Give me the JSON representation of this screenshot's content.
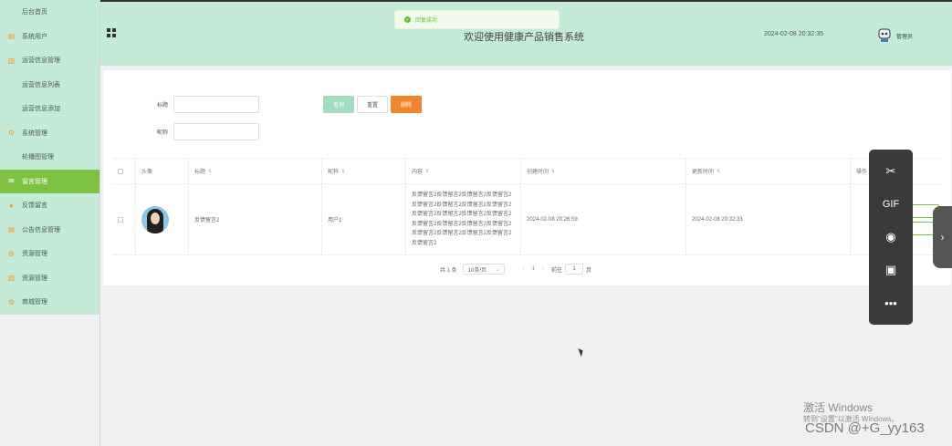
{
  "sidebar": {
    "items": [
      {
        "label": "后台首页",
        "type": "sub"
      },
      {
        "label": "系统用户",
        "icon": "document-icon",
        "type": "top"
      },
      {
        "label": "运营信息管理",
        "icon": "chart-icon",
        "type": "top"
      },
      {
        "label": "运营信息列表",
        "type": "sub"
      },
      {
        "label": "运营信息添加",
        "type": "sub"
      },
      {
        "label": "系统管理",
        "icon": "gear-icon",
        "type": "top"
      },
      {
        "label": "轮播图管理",
        "type": "sub"
      },
      {
        "label": "留言管理",
        "icon": "message-icon",
        "type": "top-active"
      },
      {
        "label": "反馈留言",
        "icon": "location-icon",
        "type": "top"
      },
      {
        "label": "公告信息管理",
        "icon": "document-icon",
        "type": "top"
      },
      {
        "label": "资源管理",
        "icon": "gear-icon",
        "type": "top"
      },
      {
        "label": "资源管理",
        "icon": "chart-icon",
        "type": "top"
      },
      {
        "label": "商城管理",
        "icon": "gear-icon",
        "type": "top"
      }
    ]
  },
  "header": {
    "title": "欢迎使用健康产品销售系统",
    "datetime": "2024-02-08 20:32:35",
    "user": "管理员"
  },
  "toast": {
    "message": "回复成功"
  },
  "search": {
    "title_label": "标题",
    "nickname_label": "昵称",
    "query_button": "查询",
    "reset_button": "重置",
    "delete_button": "删除"
  },
  "table": {
    "headers": [
      "",
      "头像",
      "标题",
      "昵称",
      "内容",
      "创建时间",
      "更新时间",
      "操作"
    ],
    "rows": [
      {
        "title": "反馈留言2",
        "nickname": "用户1",
        "content": "反馈留言2反馈留言2反馈留言2反馈留言2反馈留言2反馈留言2反馈留言2反馈留言2反馈留言2反馈留言2反馈留言2反馈留言2反馈留言2反馈留言2反馈留言2反馈留言2反馈留言2反馈留言2反馈留言2反馈留言2反馈留言2",
        "created": "2024-02-08 20:26:59",
        "updated": "2024-02-08 20:32:33"
      }
    ]
  },
  "pagination": {
    "total": "共 1 条",
    "page_size": "10条/页",
    "current_page": "1",
    "goto_label": "前往",
    "goto_value": "1",
    "page_suffix": "页"
  },
  "float_toolbar": {
    "icons": [
      "scissors-icon",
      "gif-icon",
      "record-icon",
      "image-icon",
      "more-icon"
    ],
    "gif_label": "GIF"
  },
  "watermarks": {
    "windows_title": "激活 Windows",
    "windows_sub": "转到\"设置\"以激活 Windows。",
    "csdn": "CSDN @+G_yy163"
  },
  "colors": {
    "menu_bg": "#c5ead7",
    "active": "#7fc241",
    "delete": "#f0852d",
    "query": "#a3dcc0"
  }
}
